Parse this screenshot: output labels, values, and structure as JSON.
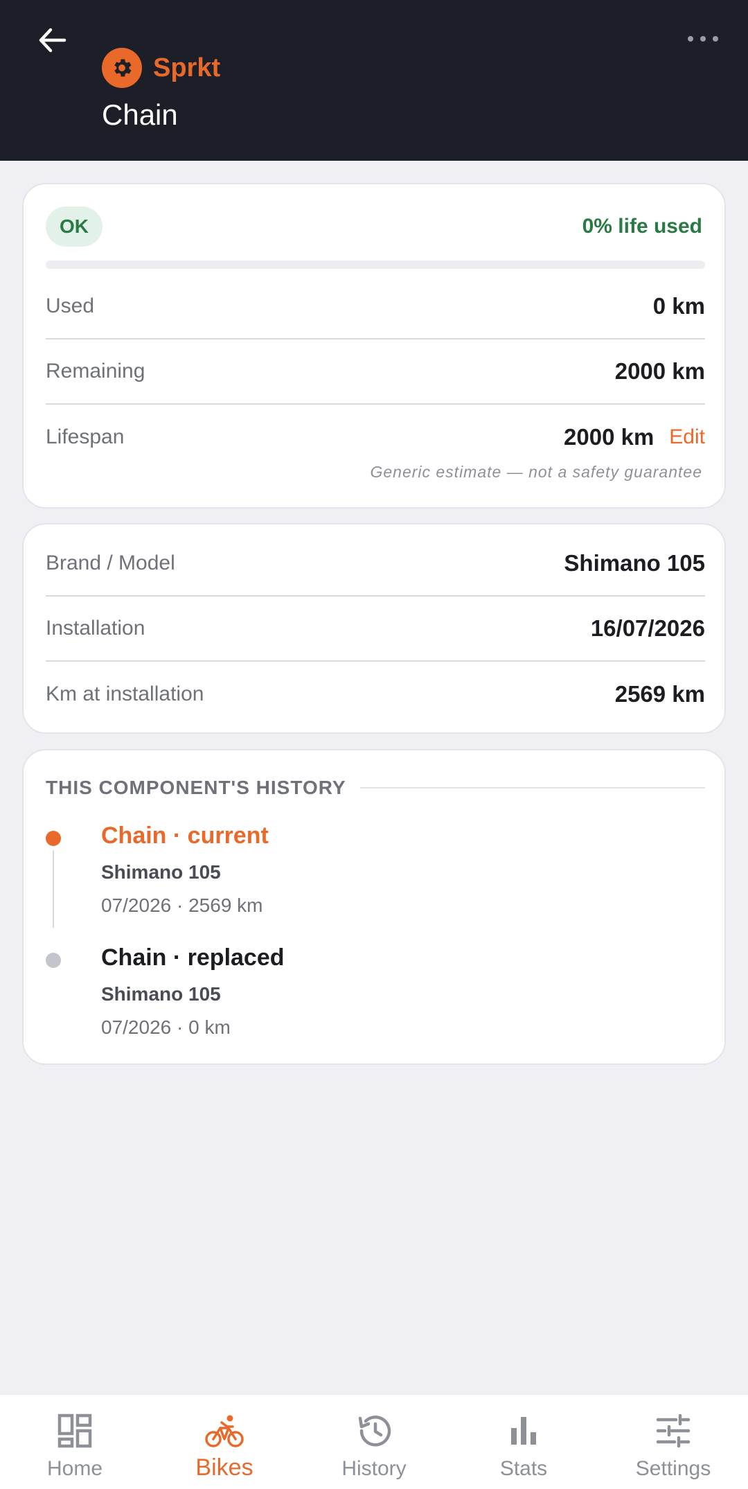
{
  "header": {
    "bike_name": "Sprkt",
    "title": "Chain",
    "back_icon": "arrow-left-icon",
    "more_icon": "more-horizontal-icon",
    "bike_icon": "gear-icon"
  },
  "status": {
    "badge": "OK",
    "life_used": "0% life used",
    "life_used_fraction": 0
  },
  "usage": {
    "used_label": "Used",
    "used_value": "0 km",
    "remaining_label": "Remaining",
    "remaining_value": "2000 km",
    "lifespan_label": "Lifespan",
    "lifespan_value": "2000 km",
    "edit_label": "Edit",
    "disclaimer": "Generic estimate — not a safety guarantee"
  },
  "details": {
    "brand_label": "Brand / Model",
    "brand_value": "Shimano 105",
    "install_label": "Installation",
    "install_value": "16/07/2026",
    "km_label": "Km at installation",
    "km_value": "2569 km"
  },
  "history": {
    "title": "THIS COMPONENT'S HISTORY",
    "items": [
      {
        "title": "Chain · current",
        "model": "Shimano 105",
        "meta": "07/2026 · 2569 km",
        "status": "current"
      },
      {
        "title": "Chain · replaced",
        "model": "Shimano 105",
        "meta": "07/2026 · 0 km",
        "status": "replaced"
      }
    ]
  },
  "nav": {
    "items": [
      {
        "label": "Home",
        "icon": "dashboard-icon"
      },
      {
        "label": "Bikes",
        "icon": "bike-icon",
        "active": true
      },
      {
        "label": "History",
        "icon": "history-icon"
      },
      {
        "label": "Stats",
        "icon": "bar-chart-icon"
      },
      {
        "label": "Settings",
        "icon": "sliders-icon"
      }
    ]
  },
  "colors": {
    "accent": "#e8692a",
    "ok_green": "#2a7a44",
    "header_bg": "#1c1f27",
    "page_bg": "#efeff4"
  }
}
